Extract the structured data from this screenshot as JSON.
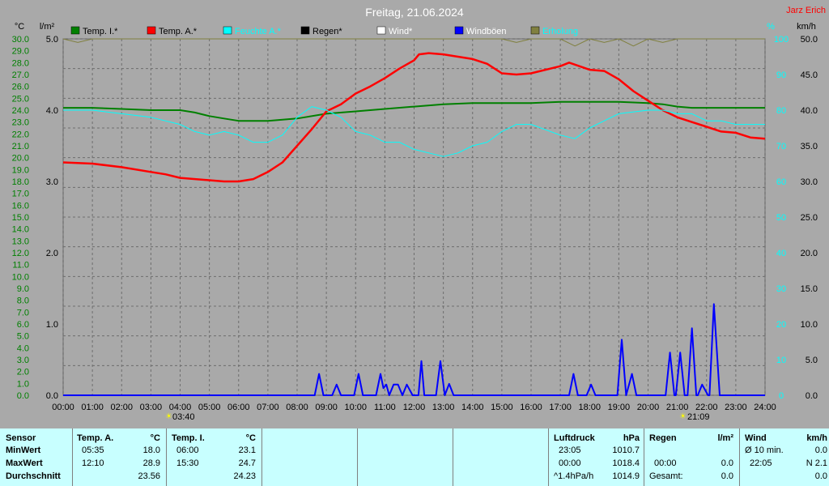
{
  "title": "Freitag, 21.06.2024",
  "author": "Jarz Erich",
  "axis_units": {
    "left_temp": "°C",
    "left_rain": "l/m²",
    "right_pct": "%",
    "right_wind": "km/h"
  },
  "legend": [
    {
      "label": "Temp. I.*",
      "color": "#008000",
      "text_color": "#000000"
    },
    {
      "label": "Temp. A.*",
      "color": "#ff0000",
      "text_color": "#000000"
    },
    {
      "label": "Feuchte A.*",
      "color": "#00ffff",
      "text_color": "#00ffff"
    },
    {
      "label": "Regen*",
      "color": "#000000",
      "text_color": "#000000"
    },
    {
      "label": "Wind*",
      "color": "#ffffff",
      "text_color": "#ffffff"
    },
    {
      "label": "Windböen",
      "color": "#0000ff",
      "text_color": "#ffffff"
    },
    {
      "label": "Erholung",
      "color": "#808040",
      "text_color": "#00ffff"
    }
  ],
  "sun_marks": {
    "sunrise": "03:40",
    "sunset": "21:09"
  },
  "chart_data": {
    "type": "line",
    "title": "Freitag, 21.06.2024",
    "x_hours": [
      0,
      1,
      2,
      3,
      4,
      5,
      6,
      7,
      8,
      9,
      10,
      11,
      12,
      13,
      14,
      15,
      16,
      17,
      18,
      19,
      20,
      21,
      22,
      23,
      24
    ],
    "x_tick_labels": [
      "00:00",
      "01:00",
      "02:00",
      "03:00",
      "04:00",
      "05:00",
      "06:00",
      "07:00",
      "08:00",
      "09:00",
      "10:00",
      "11:00",
      "12:00",
      "13:00",
      "14:00",
      "15:00",
      "16:00",
      "17:00",
      "18:00",
      "19:00",
      "20:00",
      "21:00",
      "22:00",
      "23:00",
      "24:00"
    ],
    "left_temp_axis": {
      "label": "°C",
      "min": 0,
      "max": 30,
      "step": 1
    },
    "left_rain_axis": {
      "label": "l/m²",
      "min": 0,
      "max": 5,
      "ticks": [
        "0.0",
        "1.0",
        "2.0",
        "3.0",
        "4.0",
        "5.0"
      ]
    },
    "right_pct_axis": {
      "label": "%",
      "min": 0,
      "max": 100,
      "ticks": [
        "0",
        "10",
        "20",
        "30",
        "40",
        "50",
        "60",
        "70",
        "80",
        "90",
        "100"
      ]
    },
    "right_wind_axis": {
      "label": "km/h",
      "min": 0,
      "max": 50,
      "ticks": [
        "0.0",
        "5.0",
        "10.0",
        "15.0",
        "20.0",
        "25.0",
        "30.0",
        "35.0",
        "40.0",
        "45.0",
        "50.0"
      ]
    },
    "grid": true,
    "series": [
      {
        "name": "Temp. I.*",
        "axis": "temp",
        "color": "#008000",
        "x": [
          0,
          1,
          2,
          3,
          4,
          4.5,
          5,
          5.5,
          6,
          7,
          8,
          9,
          10,
          11,
          12,
          13,
          14,
          15,
          16,
          17,
          18,
          19,
          20,
          20.5,
          21,
          21.5,
          22,
          23,
          24
        ],
        "y": [
          24.2,
          24.2,
          24.1,
          24.0,
          24.0,
          23.8,
          23.5,
          23.3,
          23.1,
          23.1,
          23.3,
          23.7,
          23.9,
          24.1,
          24.3,
          24.5,
          24.6,
          24.6,
          24.6,
          24.7,
          24.7,
          24.7,
          24.6,
          24.5,
          24.3,
          24.2,
          24.2,
          24.2,
          24.2
        ]
      },
      {
        "name": "Temp. A.*",
        "axis": "temp",
        "color": "#ff0000",
        "x": [
          0,
          1,
          2,
          3,
          3.5,
          4,
          5,
          5.5,
          6,
          6.5,
          7,
          7.5,
          8,
          8.5,
          9,
          9.5,
          10,
          10.5,
          11,
          11.5,
          12,
          12.17,
          12.5,
          13,
          14,
          14.5,
          15,
          15.5,
          16,
          17,
          17.3,
          18,
          18.5,
          19,
          19.5,
          20,
          20.5,
          21,
          21.5,
          22,
          22.5,
          23,
          23.5,
          24
        ],
        "y": [
          19.6,
          19.5,
          19.2,
          18.8,
          18.6,
          18.3,
          18.1,
          18.0,
          18.0,
          18.2,
          18.8,
          19.6,
          21.0,
          22.4,
          23.9,
          24.5,
          25.4,
          26.0,
          26.7,
          27.5,
          28.2,
          28.7,
          28.8,
          28.7,
          28.3,
          27.9,
          27.1,
          27.0,
          27.1,
          27.7,
          28.0,
          27.4,
          27.3,
          26.6,
          25.6,
          24.8,
          24.0,
          23.4,
          23.0,
          22.6,
          22.2,
          22.1,
          21.7,
          21.6
        ]
      },
      {
        "name": "Feuchte A.*",
        "axis": "pct",
        "color": "#00ffff",
        "x": [
          0,
          1,
          2,
          3,
          4,
          4.5,
          5,
          5.5,
          6,
          6.5,
          7,
          7.5,
          8,
          8.5,
          9,
          9.5,
          10,
          10.5,
          11,
          11.5,
          12,
          12.5,
          13,
          13.5,
          14,
          14.5,
          15,
          15.5,
          16,
          17,
          17.5,
          18,
          18.5,
          19,
          20,
          20.5,
          21,
          21.5,
          22,
          22.5,
          23,
          24
        ],
        "y": [
          80,
          80,
          79,
          78,
          76,
          74,
          73,
          74,
          73,
          71,
          71,
          73,
          78,
          81,
          80,
          78,
          74,
          73,
          71,
          71,
          69,
          68,
          67,
          68,
          70,
          71,
          74,
          76,
          76,
          73,
          72,
          75,
          77,
          79,
          80,
          80,
          79,
          79,
          77,
          77,
          76,
          76
        ]
      },
      {
        "name": "Erholung",
        "axis": "pct",
        "color": "#808040",
        "x": [
          0,
          0.5,
          1,
          2,
          3,
          4,
          5,
          6,
          7,
          8,
          9,
          10,
          11,
          12,
          13,
          14,
          15,
          15.5,
          16,
          17,
          17.5,
          18,
          18.5,
          19,
          19.5,
          20,
          20.5,
          21,
          21.5,
          22,
          23,
          24
        ],
        "y": [
          100,
          99,
          100,
          100,
          100,
          100,
          100,
          100,
          100,
          100,
          100,
          100,
          100,
          100,
          100,
          100,
          100,
          99,
          100,
          100,
          98,
          100,
          99,
          100,
          98,
          100,
          99,
          100,
          100,
          100,
          100,
          100
        ]
      },
      {
        "name": "Windböen",
        "axis": "wind",
        "color": "#0000ff",
        "x": [
          0,
          8.6,
          8.75,
          8.9,
          9.2,
          9.35,
          9.5,
          9.95,
          10.1,
          10.25,
          10.7,
          10.85,
          10.95,
          11.05,
          11.15,
          11.3,
          11.45,
          11.6,
          11.75,
          11.95,
          12.15,
          12.25,
          12.35,
          12.75,
          12.9,
          13.05,
          13.2,
          13.35,
          13.5,
          17.3,
          17.45,
          17.6,
          17.9,
          18.05,
          18.2,
          18.95,
          19.1,
          19.25,
          19.45,
          19.6,
          20.6,
          20.75,
          20.9,
          20.95,
          21.1,
          21.25,
          21.35,
          21.5,
          21.65,
          21.7,
          21.85,
          22.05,
          22.1,
          22.25,
          22.45,
          24
        ],
        "y": [
          0,
          0,
          3.0,
          0,
          0,
          1.5,
          0,
          0,
          3.0,
          0,
          0,
          3.0,
          1.0,
          1.5,
          0,
          1.5,
          1.5,
          0,
          1.5,
          0,
          0,
          4.8,
          0,
          0,
          4.8,
          0,
          1.6,
          0,
          0,
          0,
          3.0,
          0,
          0,
          1.5,
          0,
          0,
          7.8,
          0,
          3.0,
          0,
          0,
          6.0,
          0,
          0,
          6.0,
          0,
          0,
          9.4,
          0,
          0,
          1.5,
          0,
          0,
          12.8,
          0,
          0
        ]
      }
    ]
  },
  "stats": {
    "sensor_header": "Sensor",
    "rows": [
      "MinWert",
      "MaxWert",
      "Durchschnitt"
    ],
    "temp_a": {
      "header": "Temp. A.",
      "unit": "°C",
      "min_time": "05:35",
      "min": "18.0",
      "max_time": "12:10",
      "max": "28.9",
      "avg": "23.56"
    },
    "temp_i": {
      "header": "Temp. I.",
      "unit": "°C",
      "min_time": "06:00",
      "min": "23.1",
      "max_time": "15:30",
      "max": "24.7",
      "avg": "24.23"
    },
    "pressure": {
      "header": "Luftdruck",
      "unit": "hPa",
      "r1_time": "23:05",
      "r1": "1010.7",
      "r2_time": "00:00",
      "r2": "1018.4",
      "r3_label": "^1.4hPa/h",
      "r3": "1014.9"
    },
    "rain": {
      "header": "Regen",
      "unit": "l/m²",
      "r2_time": "00:00",
      "r2": "0.0",
      "r3_label": "Gesamt:",
      "r3": "0.0"
    },
    "wind": {
      "header": "Wind",
      "unit": "km/h",
      "r1_label": "Ø 10 min.",
      "r1": "0.0",
      "r2_time": "22:05",
      "r2": "N 2.1",
      "r3": "0.0"
    }
  }
}
